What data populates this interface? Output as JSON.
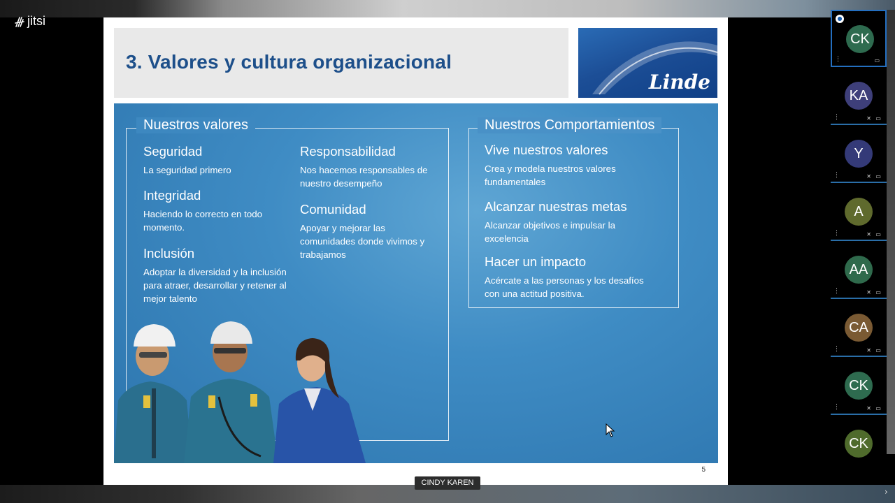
{
  "app": {
    "logo": "jitsi"
  },
  "slide": {
    "title": "3. Valores y cultura organizacional",
    "logo_text": "Linde",
    "number": "5",
    "left_section": {
      "heading": "Nuestros valores",
      "items": [
        {
          "title": "Seguridad",
          "text": "La seguridad primero"
        },
        {
          "title": "Integridad",
          "text": "Haciendo lo correcto en todo momento."
        },
        {
          "title": "Inclusión",
          "text": "Adoptar la diversidad y la inclusión para atraer, desarrollar y retener al mejor talento"
        },
        {
          "title": "Responsabilidad",
          "text": "Nos hacemos responsables de nuestro desempeño"
        },
        {
          "title": "Comunidad",
          "text": "Apoyar y mejorar las comunidades donde vivimos y trabajamos"
        }
      ]
    },
    "right_section": {
      "heading": "Nuestros Comportamientos",
      "items": [
        {
          "title": "Vive nuestros valores",
          "text": "Crea y modela nuestros valores fundamentales"
        },
        {
          "title": "Alcanzar nuestras metas",
          "text": "Alcanzar objetivos e impulsar la excelencia"
        },
        {
          "title": "Hacer un impacto",
          "text": "Acércate a las personas y los desafíos con una actitud positiva."
        }
      ]
    }
  },
  "speaker": {
    "name": "CINDY KAREN"
  },
  "participants": [
    {
      "initials": "CK",
      "color": "#2e6b4f",
      "active": true
    },
    {
      "initials": "KA",
      "color": "#3e3f7a"
    },
    {
      "initials": "Y",
      "color": "#343a78"
    },
    {
      "initials": "A",
      "color": "#5f6a2d"
    },
    {
      "initials": "AA",
      "color": "#2f6a4c"
    },
    {
      "initials": "CA",
      "color": "#7a5a33"
    },
    {
      "initials": "CK",
      "color": "#2e6b4f"
    },
    {
      "initials": "CK",
      "color": "#4f6b2c"
    }
  ],
  "icons": {
    "menu": "more-vertical-icon",
    "muted": "mic-off-icon",
    "video_off": "video-off-icon",
    "pin": "pin-icon",
    "cursor": "cursor-icon"
  }
}
